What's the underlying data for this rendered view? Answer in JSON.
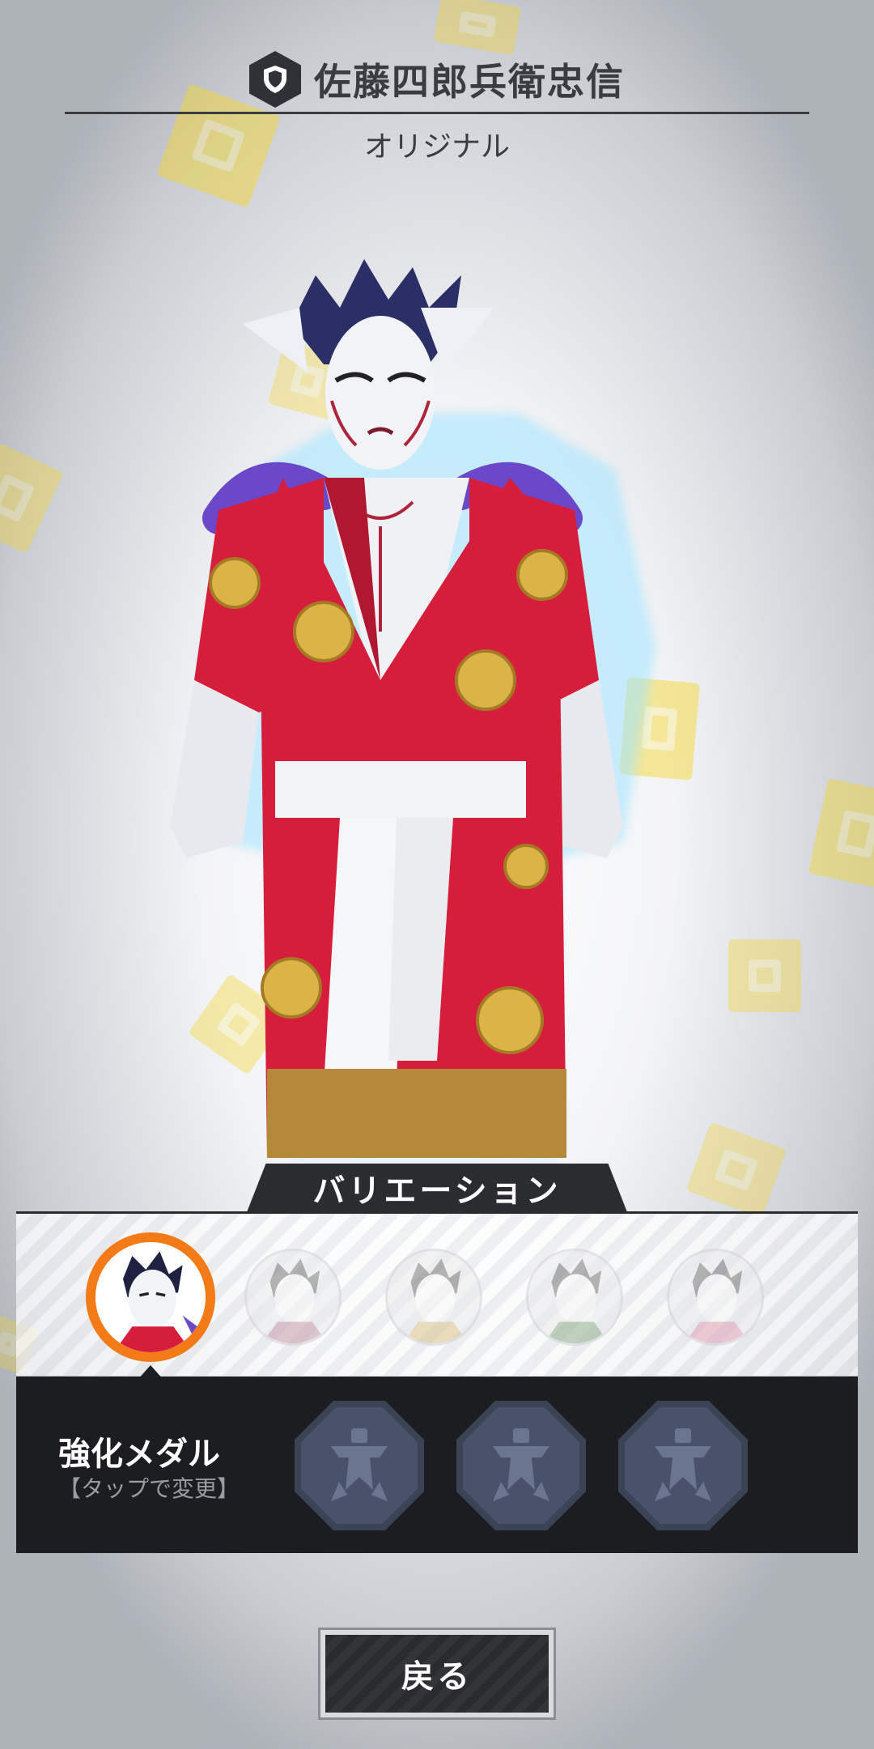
{
  "header": {
    "character_name": "佐藤四郎兵衛忠信",
    "subtitle": "オリジナル",
    "badge_icon": "shield-icon"
  },
  "variation": {
    "tab_label": "バリエーション",
    "items": [
      {
        "label": "variation-1",
        "selected": true
      },
      {
        "label": "variation-2",
        "selected": false
      },
      {
        "label": "variation-3",
        "selected": false
      },
      {
        "label": "variation-4",
        "selected": false
      },
      {
        "label": "variation-5",
        "selected": false
      }
    ]
  },
  "medal": {
    "title": "強化メダル",
    "hint": "【タップで変更】",
    "slot_icon": "empty-medal-icon"
  },
  "footer": {
    "back_label": "戻る"
  },
  "colors": {
    "accent_orange": "#f37a16",
    "dark_panel": "#1c1d20",
    "medal_slot": "#3b4456",
    "deco_yellow": "#f4d52a"
  }
}
